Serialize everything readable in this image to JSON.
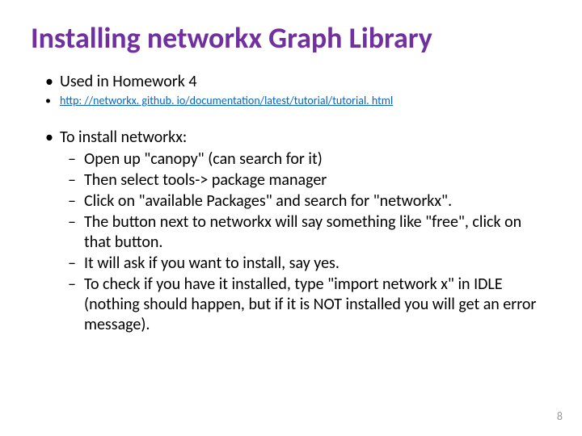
{
  "title": "Installing networkx Graph Library",
  "bullets": {
    "used_in": "Used in Homework 4",
    "link_text": "http: //networkx. github. io/documentation/latest/tutorial/tutorial. html",
    "to_install": "To install networkx:",
    "steps": {
      "s1": "Open up \"canopy\" (can search for it)",
      "s2": "Then select tools-> package manager",
      "s3": "Click on \"available Packages\" and search for \"networkx\".",
      "s4": "The button next to networkx will say something like \"free\", click on that button.",
      "s5": "It will ask if you want to install, say yes.",
      "s6": "To check if you have it installed, type \"import network x\" in IDLE (nothing should happen, but if it is NOT installed you will get an error message)."
    }
  },
  "page_number": "8"
}
